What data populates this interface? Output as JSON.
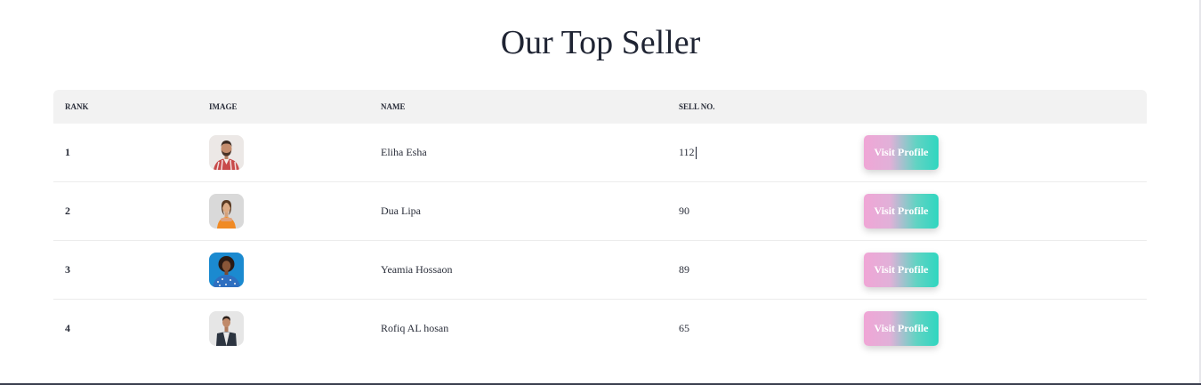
{
  "title": "Our Top Seller",
  "table": {
    "headers": {
      "rank": "RANK",
      "image": "IMAGE",
      "name": "NAME",
      "sell": "SELL NO."
    },
    "rows": [
      {
        "rank": "1",
        "name": "Eliha Esha",
        "sell": "112",
        "button": "Visit Profile",
        "avatar": "man-with-beard-plaid-shirt"
      },
      {
        "rank": "2",
        "name": "Dua Lipa",
        "sell": "90",
        "button": "Visit Profile",
        "avatar": "woman-orange-top"
      },
      {
        "rank": "3",
        "name": "Yeamia Hossaon",
        "sell": "89",
        "button": "Visit Profile",
        "avatar": "woman-curly-hair-blue-background"
      },
      {
        "rank": "4",
        "name": "Rofiq AL hosan",
        "sell": "65",
        "button": "Visit Profile",
        "avatar": "man-dark-jacket"
      }
    ]
  },
  "colors": {
    "button_gradient_start": "#f0a6d6",
    "button_gradient_end": "#2fd6c0",
    "header_background": "#f2f2f2",
    "title_text": "#1f2433"
  }
}
